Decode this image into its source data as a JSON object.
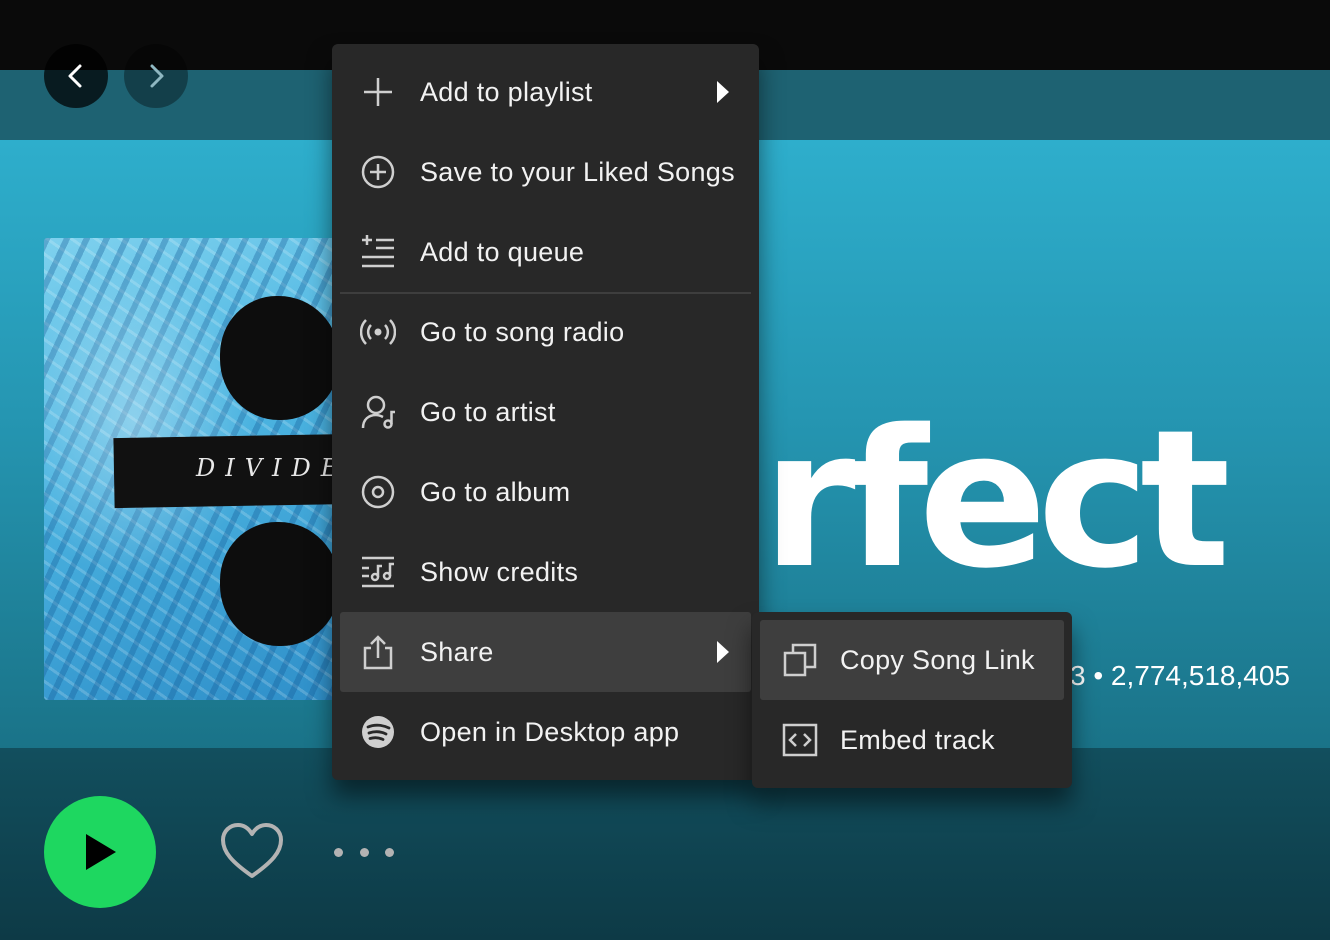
{
  "nav": {
    "back_icon": "chevron-left-icon",
    "forward_icon": "chevron-right-icon"
  },
  "album": {
    "cover_text": "DIVIDE"
  },
  "track": {
    "title_visible": "rfect",
    "meta_visible": "3 • 2,774,518,405"
  },
  "controls": {
    "play_icon": "play-icon",
    "like_icon": "heart-icon",
    "more_icon": "more-dots-icon"
  },
  "context_menu": {
    "items": [
      {
        "label": "Add to playlist",
        "icon": "plus-icon",
        "has_submenu": true
      },
      {
        "label": "Save to your Liked Songs",
        "icon": "plus-circle-icon"
      },
      {
        "label": "Add to queue",
        "icon": "queue-icon"
      },
      {
        "label": "Go to song radio",
        "icon": "radio-icon"
      },
      {
        "label": "Go to artist",
        "icon": "artist-icon"
      },
      {
        "label": "Go to album",
        "icon": "album-icon"
      },
      {
        "label": "Show credits",
        "icon": "credits-icon"
      },
      {
        "label": "Share",
        "icon": "share-icon",
        "has_submenu": true,
        "highlighted": true
      },
      {
        "label": "Open in Desktop app",
        "icon": "spotify-icon"
      }
    ]
  },
  "share_submenu": {
    "items": [
      {
        "label": "Copy Song Link",
        "icon": "copy-icon",
        "highlighted": true
      },
      {
        "label": "Embed track",
        "icon": "embed-icon"
      }
    ]
  },
  "colors": {
    "accent_green": "#1ed760",
    "menu_bg": "#282828",
    "menu_highlight": "#3e3e3e",
    "hero_teal": "#2eaecc"
  }
}
